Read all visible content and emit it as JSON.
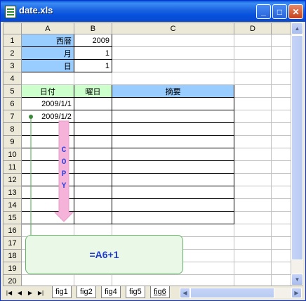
{
  "window": {
    "title": "date.xls"
  },
  "columns": [
    "A",
    "B",
    "C",
    "D"
  ],
  "rows": [
    "1",
    "2",
    "3",
    "4",
    "5",
    "6",
    "7",
    "8",
    "9",
    "10",
    "11",
    "12",
    "13",
    "14",
    "15",
    "16",
    "17",
    "18",
    "19",
    "20"
  ],
  "cells": {
    "a1": "西暦",
    "b1": "2009",
    "a2": "月",
    "b2": "1",
    "a3": "日",
    "b3": "1",
    "a5": "日付",
    "b5": "曜日",
    "c5": "摘要",
    "a6": "2009/1/1",
    "a7": "2009/1/2"
  },
  "annotation": {
    "copy_letters": [
      "C",
      "O",
      "P",
      "Y"
    ],
    "formula": "=A6+1"
  },
  "sheet_tabs": [
    "fig1",
    "fig2",
    "fig4",
    "fig5",
    "fig6"
  ],
  "active_tab": "fig6",
  "colors": {
    "label_blue": "#99ccff",
    "header_green": "#ccffcc",
    "arrow_pink": "#f5b3d9",
    "callout_bg": "#eaf8e8"
  },
  "icons": [
    "excel-doc-icon",
    "minimize-icon",
    "maximize-icon",
    "close-icon",
    "scroll-up-icon",
    "scroll-down-icon",
    "scroll-left-icon",
    "scroll-right-icon",
    "first-sheet-icon",
    "prev-sheet-icon",
    "next-sheet-icon",
    "last-sheet-icon"
  ]
}
